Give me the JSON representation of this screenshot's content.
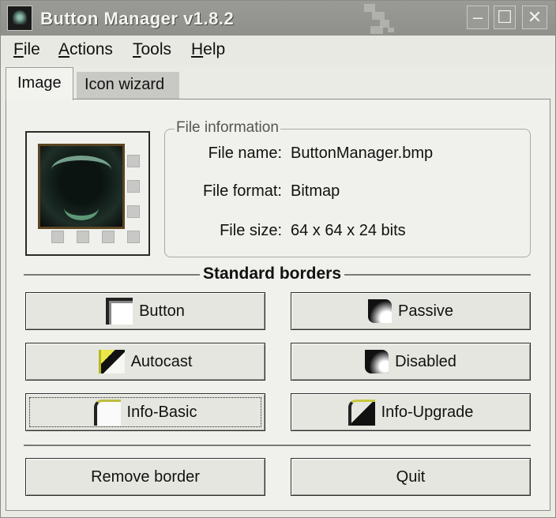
{
  "window": {
    "title": "Button Manager v1.8.2",
    "controls": {
      "minimize": "–",
      "maximize": "☐",
      "close": "✕"
    }
  },
  "menu": [
    {
      "label": "File",
      "accel": "F",
      "rest": "ile"
    },
    {
      "label": "Actions",
      "accel": "A",
      "rest": "ctions"
    },
    {
      "label": "Tools",
      "accel": "T",
      "rest": "ools"
    },
    {
      "label": "Help",
      "accel": "H",
      "rest": "elp"
    }
  ],
  "tabs": [
    {
      "label": "Image",
      "active": true
    },
    {
      "label": "Icon wizard",
      "active": false
    }
  ],
  "file_info": {
    "legend": "File information",
    "rows": [
      {
        "label": "File name:",
        "value": "ButtonManager.bmp"
      },
      {
        "label": "File format:",
        "value": "Bitmap"
      },
      {
        "label": "File size:",
        "value": "64 x 64 x 24 bits"
      }
    ]
  },
  "borders": {
    "section_title": "Standard borders",
    "buttons": [
      {
        "label": "Button",
        "icon": "button-border-icon"
      },
      {
        "label": "Passive",
        "icon": "passive-border-icon"
      },
      {
        "label": "Autocast",
        "icon": "autocast-border-icon"
      },
      {
        "label": "Disabled",
        "icon": "disabled-border-icon"
      },
      {
        "label": "Info-Basic",
        "icon": "info-basic-border-icon"
      },
      {
        "label": "Info-Upgrade",
        "icon": "info-upgrade-border-icon"
      }
    ]
  },
  "actions": {
    "remove_border": "Remove border",
    "quit": "Quit"
  }
}
